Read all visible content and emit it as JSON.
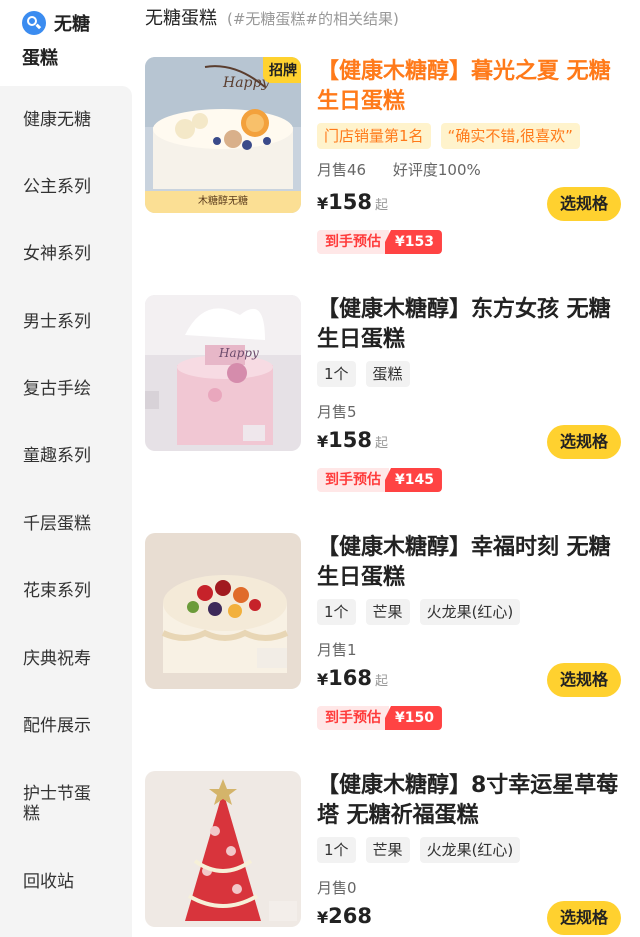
{
  "sidebar": {
    "category_line1": "无糖",
    "category_line2": "蛋糕",
    "items": [
      {
        "label": "健康无糖"
      },
      {
        "label": "公主系列"
      },
      {
        "label": "女神系列"
      },
      {
        "label": "男士系列"
      },
      {
        "label": "复古手绘"
      },
      {
        "label": "童趣系列"
      },
      {
        "label": "千层蛋糕"
      },
      {
        "label": "花束系列"
      },
      {
        "label": "庆典祝寿"
      },
      {
        "label": "配件展示"
      },
      {
        "label": "护士节蛋\n糕"
      },
      {
        "label": "回收站"
      }
    ]
  },
  "header": {
    "title": "无糖蛋糕",
    "subtitle": "(#无糖蛋糕#的相关结果)"
  },
  "products": [
    {
      "name": "【健康木糖醇】暮光之夏 无糖生日蛋糕",
      "badge": "招牌",
      "thumb_caption": "木糖醇无糖",
      "tags": [
        "门店销量第1名",
        "“确实不错,很喜欢”"
      ],
      "sales": "月售46",
      "rating": "好评度100%",
      "yen": "¥",
      "price": "158",
      "price_suffix": "起",
      "spec_button": "选规格",
      "est_label": "到手预估",
      "est_price": "¥153"
    },
    {
      "name": "【健康木糖醇】东方女孩 无糖生日蛋糕",
      "tags": [
        "1个",
        "蛋糕"
      ],
      "sales": "月售5",
      "yen": "¥",
      "price": "158",
      "price_suffix": "起",
      "spec_button": "选规格",
      "est_label": "到手预估",
      "est_price": "¥145"
    },
    {
      "name": "【健康木糖醇】幸福时刻 无糖生日蛋糕",
      "tags": [
        "1个",
        "芒果",
        "火龙果(红心)"
      ],
      "sales": "月售1",
      "yen": "¥",
      "price": "168",
      "price_suffix": "起",
      "spec_button": "选规格",
      "est_label": "到手预估",
      "est_price": "¥150"
    },
    {
      "name": "【健康木糖醇】8寸幸运星草莓塔 无糖祈福蛋糕",
      "tags": [
        "1个",
        "芒果",
        "火龙果(红心)"
      ],
      "sales": "月售0",
      "yen": "¥",
      "price": "268",
      "spec_button": "选规格"
    }
  ],
  "colors": {
    "accent_orange": "#ff7a1a",
    "button_yellow": "#ffd12f",
    "estimate_red": "#ff4343",
    "search_blue": "#3b8cf0"
  }
}
